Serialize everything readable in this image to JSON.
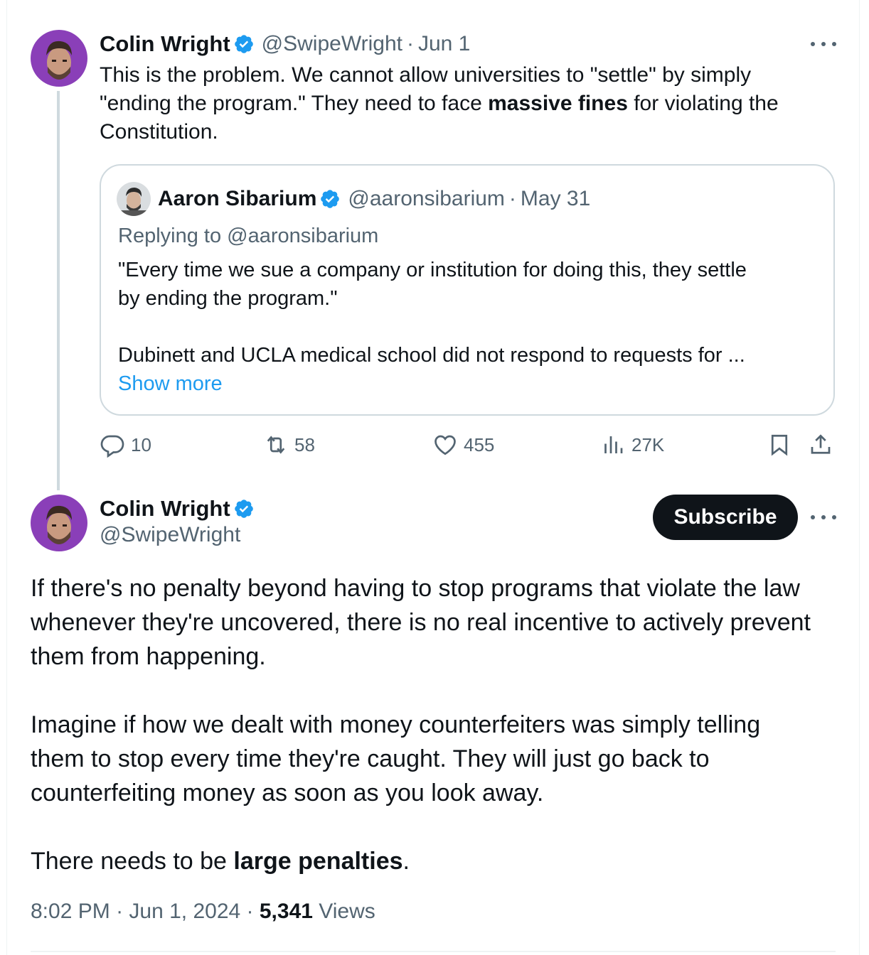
{
  "thread": {
    "tweet1": {
      "author_name": "Colin Wright",
      "handle": "@SwipeWright",
      "separator": "·",
      "date": "Jun 1",
      "text_line1": "This is the problem. We cannot allow universities to \"settle\" by simply",
      "text_line2_a": "\"ending the program.\" They need to face ",
      "text_line2_bold": "massive fines",
      "text_line2_b": " for violating the",
      "text_line3": "Constitution."
    },
    "quote": {
      "author_name": "Aaron Sibarium",
      "handle": "@aaronsibarium",
      "separator": "·",
      "date": "May 31",
      "replying_to": "Replying to @aaronsibarium",
      "text_line1": "\"Every time we sue a company or institution for doing this, they settle",
      "text_line2": "by ending the program.\"",
      "text_line3": "Dubinett and UCLA medical school did not respond to requests for ...",
      "show_more": "Show more"
    },
    "actions": {
      "replies": "10",
      "reposts": "58",
      "likes": "455",
      "views": "27K"
    },
    "tweet2": {
      "author_name": "Colin Wright",
      "handle": "@SwipeWright",
      "subscribe_label": "Subscribe",
      "p1_line1": "If there's no penalty beyond having to stop programs that violate the law",
      "p1_line2": "whenever they're uncovered, there is no real incentive to actively prevent",
      "p1_line3": "them from happening.",
      "p2_line1": "Imagine if how we dealt with money counterfeiters was simply telling",
      "p2_line2": "them to stop every time they're caught. They will just go back to",
      "p2_line3": "counterfeiting money as soon as you look away.",
      "p3_a": "There needs to be ",
      "p3_bold": "large penalties",
      "p3_b": ".",
      "time": "8:02 PM",
      "sep1": " · ",
      "date": "Jun 1, 2024",
      "sep2": " · ",
      "views_count": "5,341",
      "views_label": " Views"
    }
  },
  "colors": {
    "verified_blue": "#1d9bf0",
    "text_primary": "#0f1419",
    "text_muted": "#536471",
    "border": "#cfd9de",
    "subscribe_bg": "#0f1419"
  },
  "icons": [
    "verified-badge-icon",
    "more-icon",
    "reply-icon",
    "repost-icon",
    "like-icon",
    "views-icon",
    "bookmark-icon",
    "share-icon"
  ]
}
